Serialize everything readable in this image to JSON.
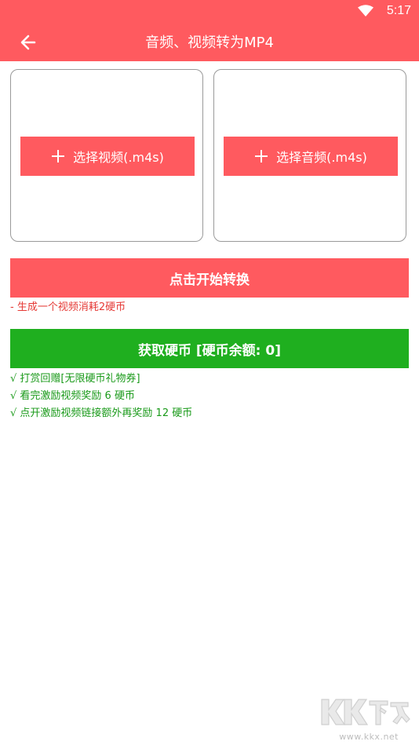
{
  "status_bar": {
    "time": "5:17",
    "wifi_icon": "wifi-icon"
  },
  "toolbar": {
    "back_icon": "arrow-left-icon",
    "title": "音频、视频转为MP4"
  },
  "cards": {
    "video": {
      "label": "选择视频(.m4s)",
      "icon": "plus-icon"
    },
    "audio": {
      "label": "选择音频(.m4s)",
      "icon": "plus-icon"
    }
  },
  "actions": {
    "convert_label": "点击开始转换",
    "cost_note": "- 生成一个视频消耗2硬币",
    "coin_label": "获取硬币 [硬币余额: 0]",
    "benefits": [
      "√ 打赏回赠[无限硬币礼物券]",
      "√ 看完激励视频奖励 6 硬币",
      "√ 点开激励视频链接额外再奖励 12 硬币"
    ]
  },
  "watermark": {
    "logo_text": "KK下载",
    "url": "www.kkx.net"
  },
  "colors": {
    "primary": "#ff5a5f",
    "green": "#1faf1f",
    "note_red": "#e53935",
    "note_green": "#1a9a1a"
  }
}
